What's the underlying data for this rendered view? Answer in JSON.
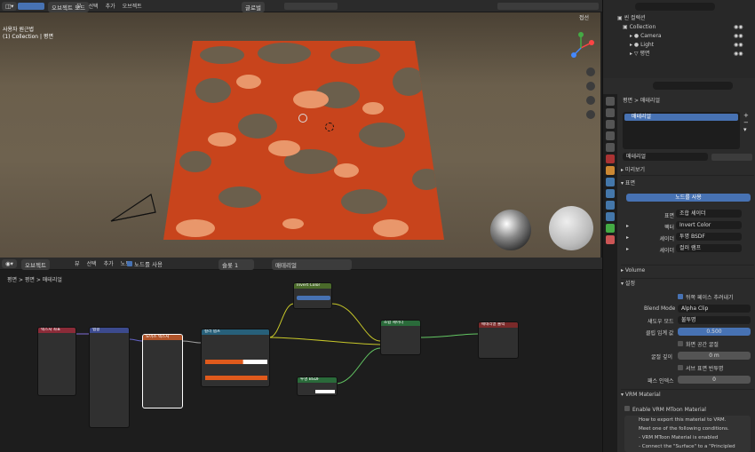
{
  "header": {
    "mode": "오브젝트 모드",
    "menus": [
      "뷰",
      "선택",
      "추가",
      "오브젝트"
    ],
    "transform": "글로벌",
    "snap": "접선"
  },
  "viewport": {
    "line1": "사용자 원근법",
    "line2": "(1) Collection | 평면"
  },
  "outliner": {
    "search_placeholder": "",
    "items": [
      {
        "label": "씬 컬렉션"
      },
      {
        "label": "Collection"
      },
      {
        "label": "Camera"
      },
      {
        "label": "Light"
      },
      {
        "label": "평면"
      }
    ]
  },
  "props": {
    "breadcrumb": [
      "평면",
      "매테리얼"
    ],
    "slot": "매테리얼",
    "material_name": "매테리얼",
    "sections": {
      "preview": "미리보기",
      "surface": "표면",
      "volume": "Volume",
      "settings": "설정",
      "vrm": "VRM Material"
    },
    "use_nodes": "노드를 사용",
    "rows": [
      {
        "label": "표면",
        "value": "조합 셰이더"
      },
      {
        "label": "팩터",
        "value": "Invert Color"
      },
      {
        "label": "셰이더",
        "value": "투명 BSDF"
      },
      {
        "label": "셰이더",
        "value": "컬러 램프"
      }
    ],
    "backface": "뒤쪽 페이스 추려내기",
    "blend_mode_label": "Blend Mode",
    "blend_mode": "Alpha Clip",
    "shadow_mode_label": "섀도우 모드",
    "shadow_mode": "불투명",
    "clip_label": "클립 임계 값",
    "clip_value": "0.500",
    "screen_space": "화면 공간 굴절",
    "refr_depth_label": "굴절 깊이",
    "refr_depth": "0 m",
    "subsurface": "서브 표면 반투명",
    "pass_index_label": "패스 인덱스",
    "pass_index": "0",
    "vrm_enable": "Enable VRM MToon Material",
    "vrm_info": [
      "How to export this material to VRM.",
      "Meet one of the following conditions.",
      "- VRM MToon Material is enabled",
      "- Connect the \"Surface\" to a \"Principled BSDF\""
    ]
  },
  "node_editor": {
    "mode": "오브젝트",
    "menus": [
      "뷰",
      "선택",
      "추가",
      "노드"
    ],
    "use_nodes": "노드를 사용",
    "slot": "슬롯 1",
    "material": "매테리얼",
    "breadcrumb": [
      "평면",
      "평면",
      "매테리얼"
    ]
  },
  "nodes": {
    "texcoord": "텍스처 좌표",
    "mapping": "맵핑",
    "noise": "노이즈 텍스처",
    "ramp": "컬러 램프",
    "invert": "Invert Color",
    "transparent": "투명 BSDF",
    "mix": "조합 셰이더",
    "output": "매테리얼 출력"
  }
}
